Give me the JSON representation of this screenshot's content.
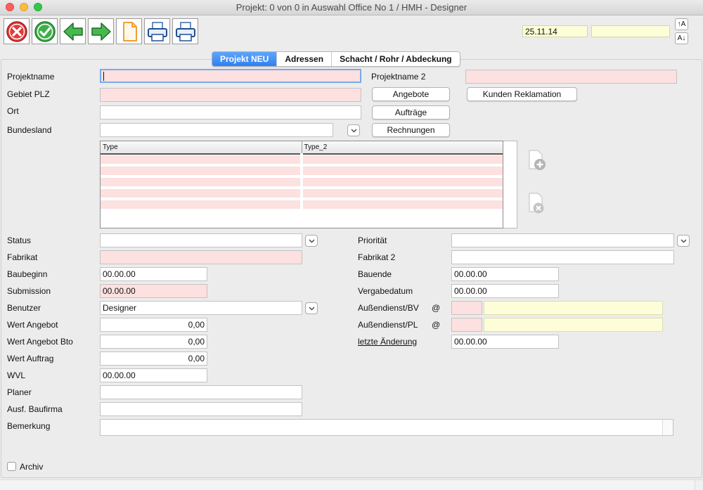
{
  "window": {
    "title": "Projekt: 0 von 0 in Auswahl Office No 1 /  HMH - Designer"
  },
  "toolbar": {
    "buttons": [
      {
        "name": "cancel-button",
        "icon": "cancel-icon"
      },
      {
        "name": "confirm-button",
        "icon": "checkmark-icon"
      },
      {
        "name": "back-button",
        "icon": "arrow-left-icon"
      },
      {
        "name": "forward-button",
        "icon": "arrow-right-icon"
      },
      {
        "name": "new-document-button",
        "icon": "document-icon"
      },
      {
        "name": "print-button",
        "icon": "printer-icon"
      },
      {
        "name": "print-preview-button",
        "icon": "printer-icon"
      }
    ],
    "date": "25.11.14",
    "extra": "",
    "font_up": "↑A",
    "font_down": "A↓"
  },
  "tabs": [
    {
      "label": "Projekt NEU",
      "active": true
    },
    {
      "label": "Adressen",
      "active": false
    },
    {
      "label": "Schacht / Rohr / Abdeckung",
      "active": false
    }
  ],
  "form": {
    "projektname_label": "Projektname",
    "projektname_value": "",
    "projektname2_label": "Projektname 2",
    "projektname2_value": "",
    "gebiet_label": "Gebiet PLZ",
    "gebiet_value": "",
    "ort_label": "Ort",
    "ort_value": "",
    "bundesland_label": "Bundesland",
    "bundesland_value": "",
    "status_label": "Status",
    "status_value": "",
    "prioritaet_label": "Priorität",
    "prioritaet_value": "",
    "fabrikat_label": "Fabrikat",
    "fabrikat_value": "",
    "fabrikat2_label": "Fabrikat 2",
    "fabrikat2_value": "",
    "baubeginn_label": "Baubeginn",
    "baubeginn_value": "00.00.00",
    "bauende_label": "Bauende",
    "bauende_value": "00.00.00",
    "submission_label": "Submission",
    "submission_value": "00.00.00",
    "vergabedatum_label": "Vergabedatum",
    "vergabedatum_value": "00.00.00",
    "benutzer_label": "Benutzer",
    "benutzer_value": "Designer",
    "aussendienst_bv_label": "Außendienst/BV",
    "aussendienst_pl_label": "Außendienst/PL",
    "at_sign": "@",
    "wert_angebot_label": "Wert Angebot",
    "wert_angebot_value": "0,00",
    "wert_angebot_bto_label": "Wert Angebot Bto",
    "wert_angebot_bto_value": "0,00",
    "wert_auftrag_label": "Wert Auftrag",
    "wert_auftrag_value": "0,00",
    "letzte_aenderung_label": "letzte Änderung",
    "letzte_aenderung_value": "00.00.00",
    "wvl_label": "WVL",
    "wvl_value": "00.00.00",
    "planer_label": "Planer",
    "planer_value": "",
    "baufirma_label": "Ausf. Baufirma",
    "baufirma_value": "",
    "bemerkung_label": "Bemerkung",
    "bemerkung_value": "",
    "archiv_label": "Archiv"
  },
  "buttons": {
    "angebote": "Angebote",
    "auftraege": "Aufträge",
    "rechnungen": "Rechnungen",
    "kunden_reklamation": "Kunden Reklamation"
  },
  "grid": {
    "columns": [
      "Type",
      "Type_2"
    ],
    "rows": 5
  },
  "colors": {
    "required_field": "#fde0e0",
    "info_field": "#fdfdd8",
    "active_tab": "#2e7ff4"
  }
}
